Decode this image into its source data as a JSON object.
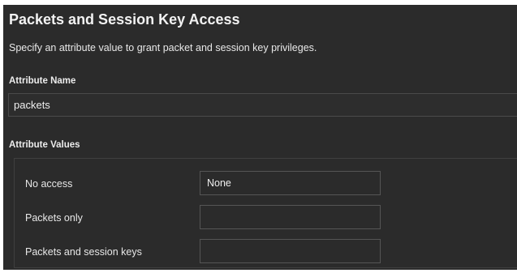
{
  "section": {
    "title": "Packets and Session Key Access",
    "description": "Specify an attribute value to grant packet and session key privileges."
  },
  "attribute_name": {
    "label": "Attribute Name",
    "value": "packets"
  },
  "attribute_values": {
    "label": "Attribute Values",
    "rows": [
      {
        "label": "No access",
        "value": "None"
      },
      {
        "label": "Packets only",
        "value": ""
      },
      {
        "label": "Packets and session keys",
        "value": ""
      }
    ]
  },
  "colors": {
    "panel_background": "#2b2b2b",
    "page_background": "#ffffff",
    "text": "#e6e6e6",
    "input_border": "#555555"
  }
}
